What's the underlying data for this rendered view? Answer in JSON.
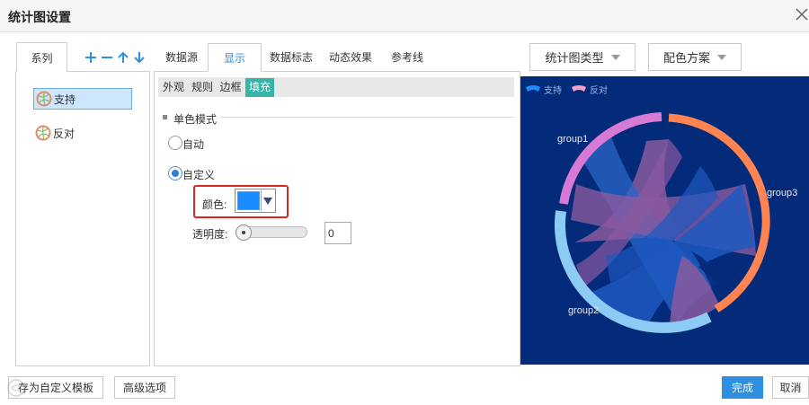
{
  "dialog": {
    "title": "统计图设置"
  },
  "series_panel": {
    "tab_label": "系列",
    "items": [
      {
        "label": "支持",
        "selected": true
      },
      {
        "label": "反对",
        "selected": false
      }
    ]
  },
  "tabs": [
    {
      "label": "数据源"
    },
    {
      "label": "显示",
      "active": true
    },
    {
      "label": "数据标志"
    },
    {
      "label": "动态效果"
    },
    {
      "label": "参考线"
    }
  ],
  "subtabs": [
    {
      "label": "外观"
    },
    {
      "label": "规则"
    },
    {
      "label": "边框"
    },
    {
      "label": "填充",
      "active": true
    }
  ],
  "fill": {
    "section_title": "单色模式",
    "mode_auto_label": "自动",
    "mode_custom_label": "自定义",
    "selected_mode": "custom",
    "color_label": "颜色:",
    "color_value": "#1a8cff",
    "opacity_label": "透明度:",
    "opacity_value": "0"
  },
  "preview": {
    "chart_type_button": "统计图类型",
    "color_scheme_button": "配色方案",
    "legend": [
      {
        "label": "支持",
        "color": "#1a8cff"
      },
      {
        "label": "反对",
        "color": "#f5a0c0"
      }
    ],
    "groups": [
      {
        "label": "group1",
        "color": "#d77ad5"
      },
      {
        "label": "group2",
        "color": "#8ccbf4"
      },
      {
        "label": "group3",
        "color": "#ff8451"
      }
    ]
  },
  "footer": {
    "save_template": "存为自定义模板",
    "advanced": "高级选项",
    "done": "完成",
    "cancel": "取消"
  }
}
